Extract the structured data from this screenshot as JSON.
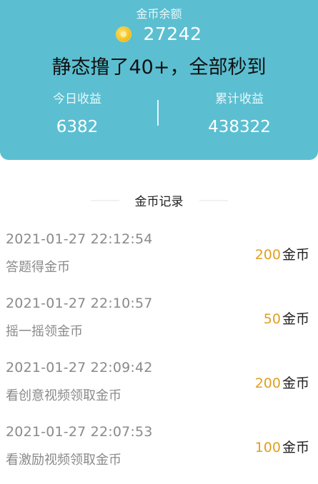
{
  "header": {
    "balance_label": "金币余额",
    "balance_value": "27242",
    "overlay_text": "静态撸了40+，全部秒到",
    "today_label": "今日收益",
    "today_value": "6382",
    "total_label": "累计收益",
    "total_value": "438322"
  },
  "section_title": "金币记录",
  "records": [
    {
      "time": "2021-01-27 22:12:54",
      "desc": "答题得金币",
      "amount": "200",
      "unit": "金币"
    },
    {
      "time": "2021-01-27 22:10:57",
      "desc": "摇一摇领金币",
      "amount": "50",
      "unit": "金币"
    },
    {
      "time": "2021-01-27 22:09:42",
      "desc": "看创意视频领取金币",
      "amount": "200",
      "unit": "金币"
    },
    {
      "time": "2021-01-27 22:07:53",
      "desc": "看激励视频领取金币",
      "amount": "100",
      "unit": "金币"
    }
  ],
  "colors": {
    "header_bg": "#5bbfd1",
    "amount": "#e0a020"
  }
}
